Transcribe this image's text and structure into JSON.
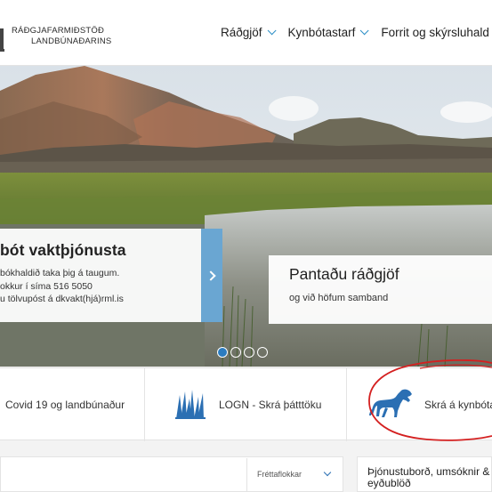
{
  "brand": {
    "line1": "RÁÐGJAFARMIÐSTÖÐ",
    "line2": "LANDBÚNAÐARINS"
  },
  "nav": {
    "items": [
      {
        "label": "Ráðgjöf"
      },
      {
        "label": "Kynbótastarf"
      },
      {
        "label": "Forrit og skýrsluhald"
      }
    ]
  },
  "hero": {
    "slide_left": {
      "title": "bót vaktþjónusta",
      "line1": "bókhaldið taka þig á taugum.",
      "line2": "okkur í síma 516 5050",
      "line3": "u tölvupóst á dkvakt(hjá)rml.is"
    },
    "slide_right": {
      "title": "Pantaðu ráðgjöf",
      "text": "og við höfum samband"
    },
    "carousel": {
      "count": 4,
      "active": 1
    }
  },
  "quick_links": [
    {
      "label": "Covid 19 og landbúnaður",
      "icon": "none"
    },
    {
      "label": "LOGN - Skrá þátttöku",
      "icon": "grass-icon"
    },
    {
      "label": "Skrá á kynbóta",
      "icon": "horse-icon"
    }
  ],
  "news": {
    "filter_label": "Fréttaflokkar"
  },
  "side": {
    "line1": "Þjónustuborð, umsóknir &",
    "line2": "eyðublöð"
  },
  "colors": {
    "accent": "#2b8ec6",
    "icon_blue": "#2b6fb3",
    "annotation": "#d42020",
    "arrow_bg": "#6aa6d2"
  }
}
